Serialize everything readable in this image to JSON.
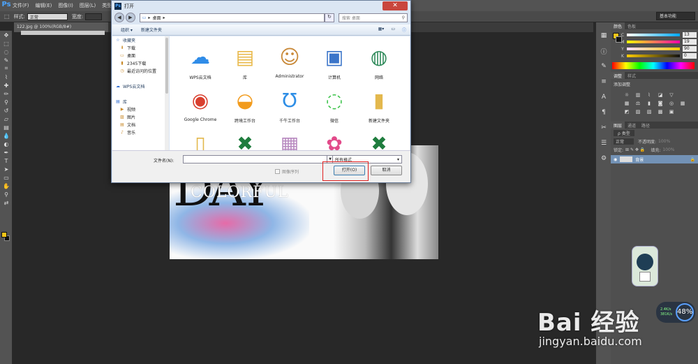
{
  "menubar": {
    "logo": "Ps",
    "items": [
      "文件(F)",
      "编辑(E)",
      "图像(I)",
      "图层(L)",
      "类型(Y)"
    ]
  },
  "options": {
    "style_label": "样式:",
    "style_value": "正常",
    "width_label": "宽度:",
    "workspace": "基本功能"
  },
  "document": {
    "tab": "122.jpg @ 100%(RGB/8#)"
  },
  "canvas": {
    "big_text": "DAY",
    "colorful_text": "COLORFUL"
  },
  "panels": {
    "color_tabs": [
      "颜色",
      "色板"
    ],
    "cmyk": [
      {
        "ch": "C",
        "val": "13"
      },
      {
        "ch": "M",
        "val": "19"
      },
      {
        "ch": "Y",
        "val": "90"
      },
      {
        "ch": "K",
        "val": "0"
      }
    ],
    "adjust_tabs": [
      "调整",
      "样式"
    ],
    "adjust_title": "添加调整",
    "layers_tabs": [
      "图层",
      "通道",
      "路径"
    ],
    "layers_kind": "ρ 类型",
    "blend_mode": "正常",
    "opacity_label": "不透明度:",
    "opacity_value": "100%",
    "lock_label": "锁定:",
    "fill_label": "填充:",
    "fill_value": "100%",
    "layer_name": "背景"
  },
  "dialog": {
    "title": "打开",
    "path": "桌面",
    "search_placeholder": "搜索 桌面",
    "organize": "组织 ▾",
    "new_folder": "新建文件夹",
    "nav": [
      {
        "label": "收藏夹",
        "hdr": true,
        "icon": "☆"
      },
      {
        "label": "下载",
        "icon": "⬇"
      },
      {
        "label": "桌面",
        "icon": "▭"
      },
      {
        "label": "2345下载",
        "icon": "▮"
      },
      {
        "label": "最近访问的位置",
        "icon": "◷"
      },
      {
        "label": "",
        "icon": ""
      },
      {
        "label": "WPS云文档",
        "hdr": true,
        "icon": "☁"
      },
      {
        "label": "",
        "icon": ""
      },
      {
        "label": "库",
        "hdr": true,
        "icon": "▤"
      },
      {
        "label": "视频",
        "icon": "▶"
      },
      {
        "label": "图片",
        "icon": "▨"
      },
      {
        "label": "文档",
        "icon": "▤"
      },
      {
        "label": "音乐",
        "icon": "♪"
      }
    ],
    "files": [
      {
        "name": "WPS云文档",
        "icon": "☁",
        "color": "#2f8ce8"
      },
      {
        "name": "库",
        "icon": "▤",
        "color": "#e9b94a"
      },
      {
        "name": "Administrator",
        "icon": "☺",
        "color": "#c98a3a"
      },
      {
        "name": "计算机",
        "icon": "▣",
        "color": "#3b75c9"
      },
      {
        "name": "网络",
        "icon": "◍",
        "color": "#2f8a5a"
      },
      {
        "name": "Google Chrome",
        "icon": "◉",
        "color": "#d9402f"
      },
      {
        "name": "跨境工作台",
        "icon": "◒",
        "color": "#f29b1d"
      },
      {
        "name": "千牛工作台",
        "icon": "Ʊ",
        "color": "#2e8ee6"
      },
      {
        "name": "微信",
        "icon": "◌",
        "color": "#3ec44c"
      },
      {
        "name": "新建文件夹",
        "icon": "▮",
        "color": "#e3b84d"
      },
      {
        "name": "",
        "icon": "▯",
        "color": "#e3b84d"
      },
      {
        "name": "",
        "icon": "✖",
        "color": "#1f7d3e"
      },
      {
        "name": "",
        "icon": "▦",
        "color": "#b88ac0"
      },
      {
        "name": "",
        "icon": "✿",
        "color": "#e24a8a"
      },
      {
        "name": "",
        "icon": "✖",
        "color": "#1f7d3e"
      }
    ],
    "filename_label": "文件名(N):",
    "filetype": "所有格式",
    "sequence_label": "图像序列",
    "open_label": "打开(O)",
    "cancel_label": "取消"
  },
  "widget": {
    "speed_up": "2.4K/s",
    "speed_down": "381K/s",
    "percent": "48%"
  },
  "watermark": {
    "brand": "Bai 经验",
    "url": "jingyan.baidu.com"
  }
}
